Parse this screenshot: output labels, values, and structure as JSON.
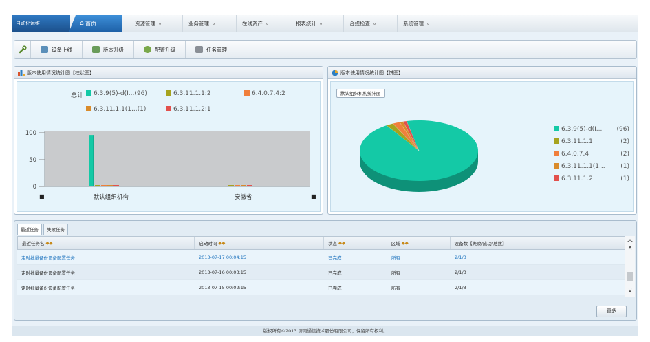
{
  "nav": {
    "brand": "自动化运维",
    "home_label": "首页",
    "menus": [
      "资源管理",
      "业务管理",
      "在线资产",
      "报表统计",
      "合规检查",
      "系统管理"
    ]
  },
  "toolbar": {
    "buttons": [
      {
        "label": "设备上线",
        "color": "#5b8fb9"
      },
      {
        "label": "版本升级",
        "color": "#6a9c5a"
      },
      {
        "label": "配置升级",
        "color": "#7aa84a"
      },
      {
        "label": "任务管理",
        "color": "#8a8f96"
      }
    ]
  },
  "bar_panel": {
    "title": "版本使用情况统计图【柱状图】",
    "legend_prefix": "总计",
    "legend": [
      {
        "label": "6.3.9(5)-d(I...(96)",
        "color": "#14c9a6"
      },
      {
        "label": "6.3.11.1.1:2",
        "color": "#a6a31e"
      },
      {
        "label": "6.4.0.7.4:2",
        "color": "#f07f3c"
      },
      {
        "label": "6.3.11.1.1(1...(1)",
        "color": "#d98b2b"
      },
      {
        "label": "6.3.11.1.2:1",
        "color": "#e2504c"
      }
    ],
    "y_ticks": [
      "100",
      "50",
      "0"
    ],
    "group_labels": [
      "默认组织机构",
      "安徽省"
    ],
    "nav_left": "■",
    "nav_right": "■"
  },
  "chart_data": {
    "type": "bar",
    "title": "版本使用情况统计图【柱状图】",
    "categories": [
      "默认组织机构",
      "安徽省"
    ],
    "ylim": [
      0,
      100
    ],
    "series": [
      {
        "name": "6.3.9(5)-d(I...",
        "values": [
          96,
          0
        ]
      },
      {
        "name": "6.3.11.1.1",
        "values": [
          2,
          1
        ]
      },
      {
        "name": "6.4.0.7.4",
        "values": [
          2,
          1
        ]
      },
      {
        "name": "6.3.11.1.1(1...",
        "values": [
          1,
          1
        ]
      },
      {
        "name": "6.3.11.1.2",
        "values": [
          1,
          1
        ]
      }
    ]
  },
  "pie_panel": {
    "title": "版本使用情况统计图【饼图】",
    "org_label": "默认组织机构统计图",
    "slices": [
      {
        "label": "6.3.9(5)-d(I...",
        "count": "(96)",
        "value": 96,
        "color": "#14c9a6"
      },
      {
        "label": "6.3.11.1.1",
        "count": "(2)",
        "value": 2,
        "color": "#a6a31e"
      },
      {
        "label": "6.4.0.7.4",
        "count": "(2)",
        "value": 2,
        "color": "#f07f3c"
      },
      {
        "label": "6.3.11.1.1(1...",
        "count": "(1)",
        "value": 1,
        "color": "#d98b2b"
      },
      {
        "label": "6.3.11.1.2",
        "count": "(1)",
        "value": 1,
        "color": "#e2504c"
      }
    ]
  },
  "tasks": {
    "tabs": [
      "最近任务",
      "失败任务"
    ],
    "columns": [
      "最近任务名",
      "启动时间",
      "状态",
      "区域",
      "设备数【失败/成功/总数】"
    ],
    "rows": [
      {
        "name": "定时批量备份设备配置任务",
        "time": "2013-07-17 00:04:15",
        "status": "已完成",
        "region": "所有",
        "count": "2/1/3"
      },
      {
        "name": "定时批量备份设备配置任务",
        "time": "2013-07-16 00:03:15",
        "status": "已完成",
        "region": "所有",
        "count": "2/1/3"
      },
      {
        "name": "定时批量备份设备配置任务",
        "time": "2013-07-15 00:02:15",
        "status": "已完成",
        "region": "所有",
        "count": "2/1/3"
      }
    ],
    "more_label": "更多"
  },
  "footer": "版权所有©2013 济南通信技术股份有限公司，保留所有权利。"
}
